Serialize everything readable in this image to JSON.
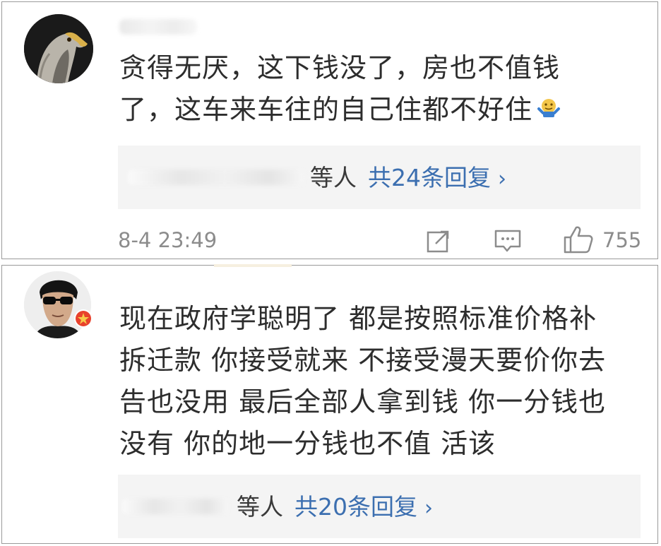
{
  "comments": [
    {
      "text_lines": [
        "贪得无厌，这下钱没了，房也不值钱",
        "了，这车来车往的自己住都不好住"
      ],
      "emoji": "shrug-emoji",
      "replies": {
        "suffix": "等人",
        "total": "共24条回复",
        "chevron": "›"
      },
      "time": "8-4 23:49",
      "likes": "755",
      "avatar": "eagle-avatar"
    },
    {
      "text_lines": [
        "现在政府学聪明了 都是按照标准价格补",
        "拆迁款 你接受就来 不接受漫天要价你去",
        "告也没用  最后全部人拿到钱 你一分钱也",
        "没有 你的地一分钱也不值 活该"
      ],
      "replies": {
        "suffix": "等人",
        "total": "共20条回复",
        "chevron": "›"
      },
      "avatar": "man-sunglasses-avatar",
      "badge_color": "#e8412c"
    }
  ],
  "colors": {
    "link": "#3c6fb0",
    "meta": "#8c8c8c",
    "reply_bg": "#f4f4f4"
  }
}
